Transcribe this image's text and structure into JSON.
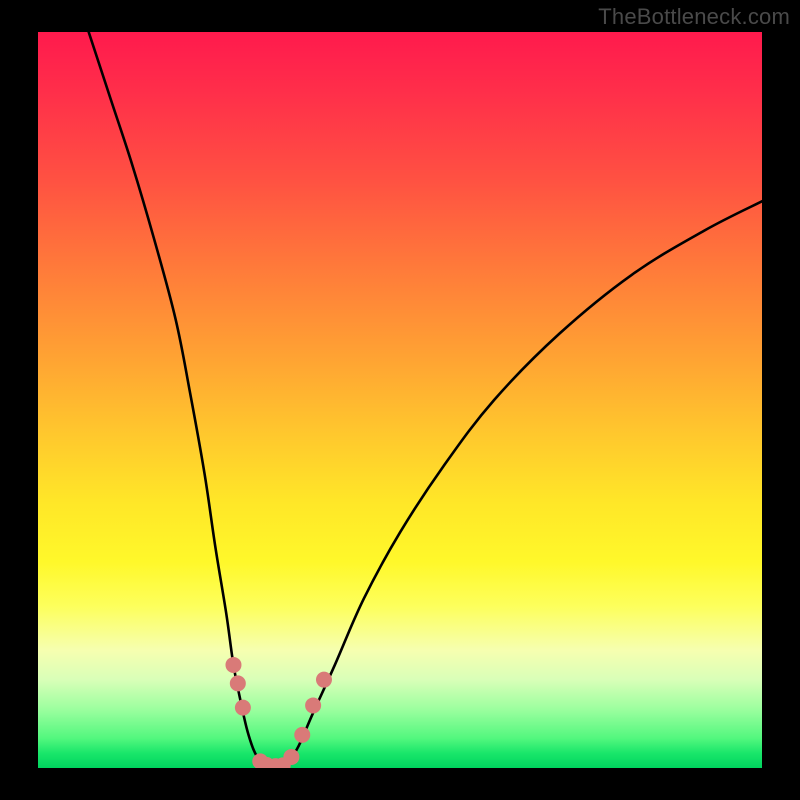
{
  "watermark": "TheBottleneck.com",
  "chart_data": {
    "type": "line",
    "title": "",
    "xlabel": "",
    "ylabel": "",
    "xlim": [
      0,
      100
    ],
    "ylim": [
      0,
      100
    ],
    "series": [
      {
        "name": "left-curve",
        "x": [
          7,
          10,
          13,
          16,
          19,
          21,
          23,
          24.5,
          26,
          27,
          28,
          28.8,
          29.5,
          30,
          30.5,
          31
        ],
        "values": [
          100,
          91,
          82,
          72,
          61,
          51,
          40,
          30,
          21,
          14,
          9,
          5.5,
          3.2,
          2.0,
          1.2,
          0.6
        ]
      },
      {
        "name": "right-curve",
        "x": [
          34.5,
          36,
          38,
          41,
          45,
          50,
          56,
          63,
          72,
          82,
          92,
          100
        ],
        "values": [
          0.6,
          3.0,
          7.5,
          14,
          23,
          32,
          41,
          50,
          59,
          67,
          73,
          77
        ]
      },
      {
        "name": "bottom-segment",
        "x": [
          31,
          32,
          33,
          34,
          34.5
        ],
        "values": [
          0.6,
          0.25,
          0.2,
          0.25,
          0.6
        ]
      }
    ],
    "markers": [
      {
        "series": "left-curve",
        "x": 27.0,
        "y": 14.0
      },
      {
        "series": "left-curve",
        "x": 27.6,
        "y": 11.5
      },
      {
        "series": "left-curve",
        "x": 28.3,
        "y": 8.2
      },
      {
        "series": "bottom-segment",
        "x": 30.7,
        "y": 0.9
      },
      {
        "series": "bottom-segment",
        "x": 31.6,
        "y": 0.4
      },
      {
        "series": "bottom-segment",
        "x": 32.8,
        "y": 0.25
      },
      {
        "series": "bottom-segment",
        "x": 33.8,
        "y": 0.35
      },
      {
        "series": "right-curve",
        "x": 35.0,
        "y": 1.5
      },
      {
        "series": "right-curve",
        "x": 36.5,
        "y": 4.5
      },
      {
        "series": "right-curve",
        "x": 38.0,
        "y": 8.5
      },
      {
        "series": "right-curve",
        "x": 39.5,
        "y": 12.0
      }
    ],
    "grid": false,
    "legend": false
  },
  "colors": {
    "marker": "#d97a78",
    "curve": "#000000",
    "background_top": "#ff1a4d",
    "background_bottom": "#00d45e"
  }
}
